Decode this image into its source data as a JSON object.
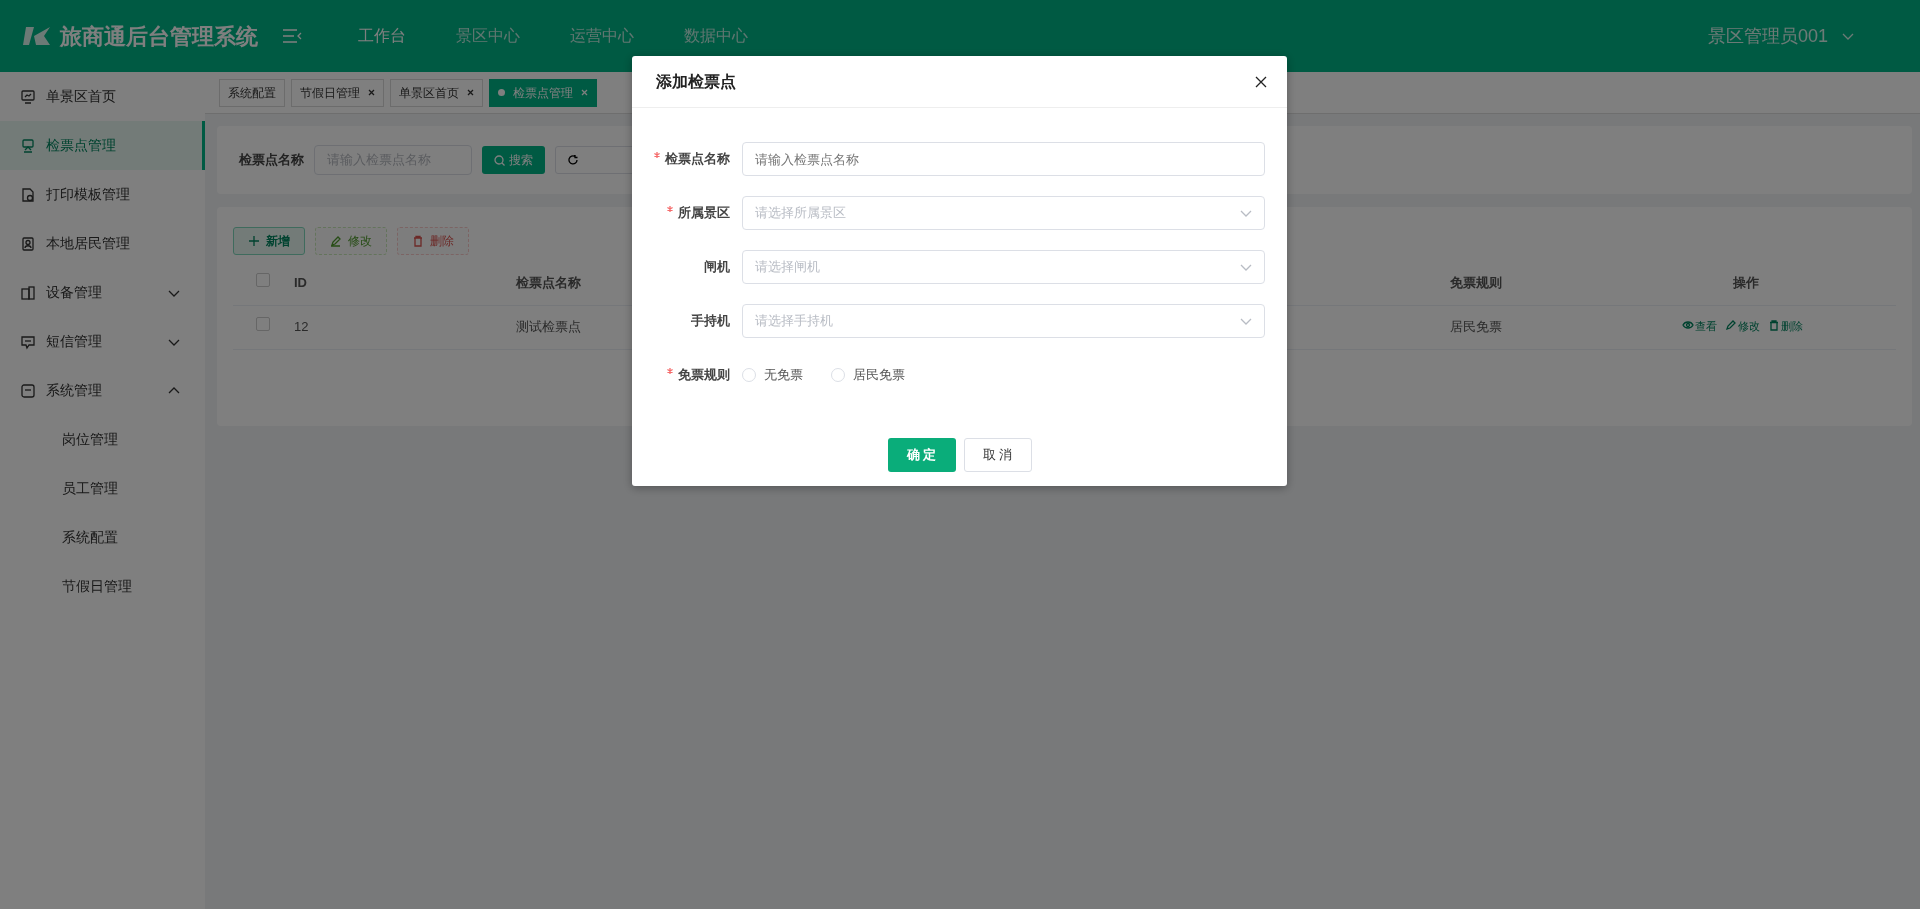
{
  "header": {
    "logo_text": "旅商通后台管理系统",
    "nav": [
      {
        "label": "工作台",
        "selected": true
      },
      {
        "label": "景区中心",
        "selected": false
      },
      {
        "label": "运营中心",
        "selected": false
      },
      {
        "label": "数据中心",
        "selected": false
      }
    ],
    "user": "景区管理员001"
  },
  "sidebar": {
    "items": [
      {
        "label": "单景区首页",
        "selected": false
      },
      {
        "label": "检票点管理",
        "selected": true
      },
      {
        "label": "打印模板管理",
        "selected": false
      },
      {
        "label": "本地居民管理",
        "selected": false
      },
      {
        "label": "设备管理",
        "selected": false,
        "expanded": false
      },
      {
        "label": "短信管理",
        "selected": false,
        "expanded": false
      },
      {
        "label": "系统管理",
        "selected": false,
        "expanded": true,
        "children": [
          {
            "label": "岗位管理",
            "selected": false
          },
          {
            "label": "员工管理",
            "selected": false
          },
          {
            "label": "系统配置",
            "selected": false
          },
          {
            "label": "节假日管理",
            "selected": false
          }
        ]
      }
    ]
  },
  "tabs": [
    {
      "label": "系统配置",
      "closable": false,
      "selected": false
    },
    {
      "label": "节假日管理",
      "closable": true,
      "selected": false
    },
    {
      "label": "单景区首页",
      "closable": true,
      "selected": false
    },
    {
      "label": "检票点管理",
      "closable": true,
      "selected": true
    }
  ],
  "search": {
    "label": "检票点名称",
    "placeholder": "请输入检票点名称",
    "button": "搜索"
  },
  "toolbar": [
    {
      "label": "新增",
      "kind": "add",
      "disabled": false
    },
    {
      "label": "修改",
      "kind": "edit",
      "disabled": true
    },
    {
      "label": "删除",
      "kind": "delete",
      "disabled": true
    }
  ],
  "table": {
    "header_checked": false,
    "columns": [
      "ID",
      "检票点名称",
      "免票规则",
      "操作"
    ],
    "rows": [
      {
        "checked": false,
        "cells": [
          "12",
          "测试检票点",
          "居民免票"
        ],
        "actions": [
          {
            "label": "查看",
            "kind": "view"
          },
          {
            "label": "修改",
            "kind": "edit"
          },
          {
            "label": "删除",
            "kind": "delete"
          }
        ]
      }
    ]
  },
  "modal": {
    "title": "添加检票点",
    "fields": [
      {
        "label": "检票点名称",
        "required": true,
        "kind": "input",
        "placeholder": "请输入检票点名称"
      },
      {
        "label": "所属景区",
        "required": true,
        "kind": "select",
        "placeholder": "请选择所属景区"
      },
      {
        "label": "闸机",
        "required": false,
        "kind": "select",
        "placeholder": "请选择闸机"
      },
      {
        "label": "手持机",
        "required": false,
        "kind": "select",
        "placeholder": "请选择手持机"
      },
      {
        "label": "免票规则",
        "required": true,
        "kind": "radio",
        "options": [
          {
            "label": "无免票",
            "selected": false
          },
          {
            "label": "居民免票",
            "selected": false
          }
        ]
      }
    ],
    "confirm": "确 定",
    "cancel": "取 消"
  }
}
